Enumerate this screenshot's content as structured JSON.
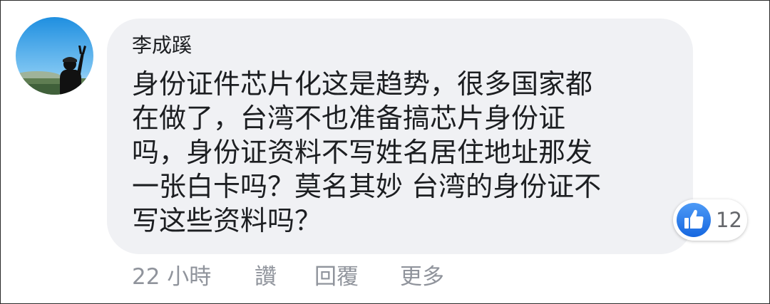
{
  "comment": {
    "author": "李成蹊",
    "text_lines": [
      "身份证件芯片化这是趋势，很多国家都",
      "在做了，台湾不也准备搞芯片身份证",
      "吗，身份证资料不写姓名居住地址那发",
      "一张白卡吗？莫名其妙 台湾的身份证不",
      "写这些资料吗？"
    ],
    "reactions": {
      "icon": "thumbs-up-icon",
      "count": "12",
      "color": "#1877f2"
    }
  },
  "actions": {
    "timestamp": "22 小時",
    "like_label": "讚",
    "reply_label": "回覆",
    "more_label": "更多"
  },
  "colors": {
    "bubble": "#f0f1f4",
    "text": "#1c1e21",
    "meta": "#90949c"
  }
}
